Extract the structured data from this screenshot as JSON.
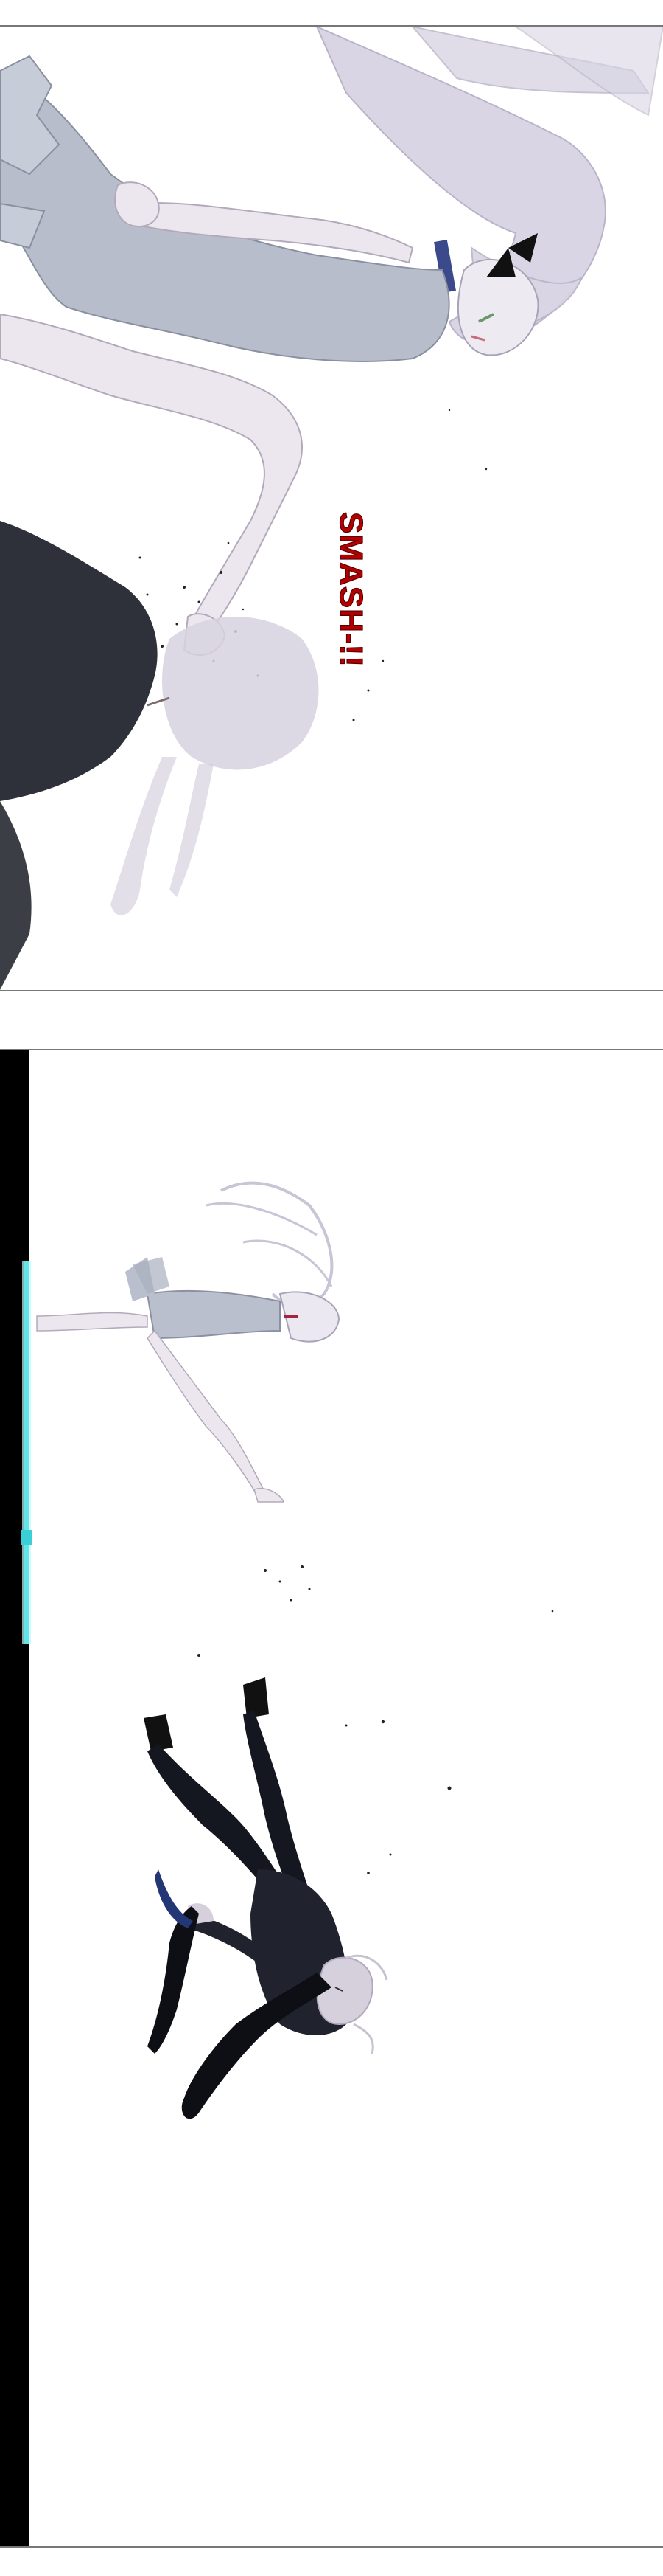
{
  "panels": [
    {
      "sfx": "SMASH-!!"
    },
    {}
  ],
  "colors": {
    "sfx_red": "#b30000",
    "hair": "#d9d5e4",
    "clothes_light": "#b7bdca",
    "clothes_dark": "#1b1d26",
    "cyan_line": "#7ff0f0",
    "black_bar": "#000000"
  }
}
